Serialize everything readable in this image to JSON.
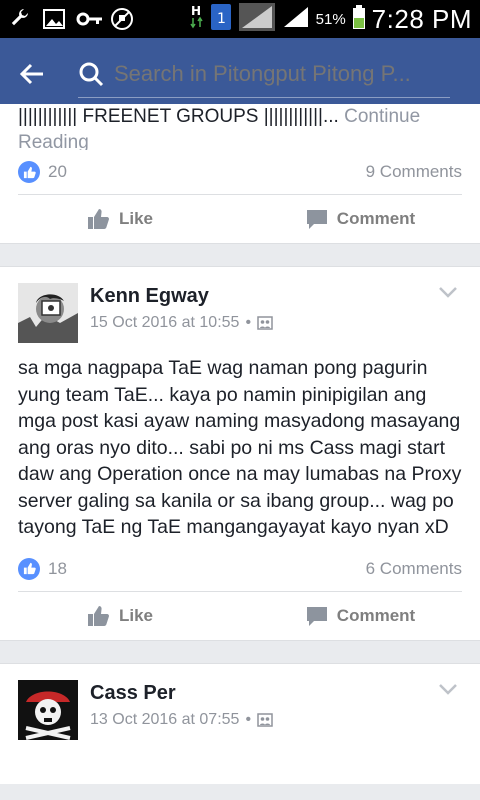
{
  "status_bar": {
    "battery_percent": "51%",
    "time": "7:28 PM",
    "icons": [
      "wrench-icon",
      "image-icon",
      "key-icon",
      "no-usb-icon",
      "data-hplus-icon",
      "sim-1-icon",
      "signal-icon",
      "battery-icon"
    ]
  },
  "app_bar": {
    "search_placeholder": "Search in Pitongput Pitong P...",
    "color": "#3b5998"
  },
  "posts": [
    {
      "snippet": "|||||||||||| FREENET GROUPS ||||||||||||...",
      "continue_label": "Continue Reading",
      "likes": "20",
      "comments": "9 Comments",
      "like_label": "Like",
      "comment_label": "Comment"
    },
    {
      "author": "Kenn Egway",
      "timestamp": "15 Oct 2016 at 10:55",
      "separator": "•",
      "body": "sa mga nagpapa TaE wag naman pong pagurin yung team TaE... kaya po namin pinipigilan ang mga post kasi ayaw naming masyadong masayang ang oras nyo dito... sabi po ni ms Cass magi start daw ang Operation once na may lumabas na Proxy server galing sa kanila or sa ibang group... wag po tayong TaE ng TaE mangangayayat kayo nyan xD",
      "likes": "18",
      "comments": "6 Comments",
      "like_label": "Like",
      "comment_label": "Comment"
    },
    {
      "author": "Cass Per",
      "timestamp": "13 Oct 2016 at 07:55",
      "separator": "•"
    }
  ]
}
